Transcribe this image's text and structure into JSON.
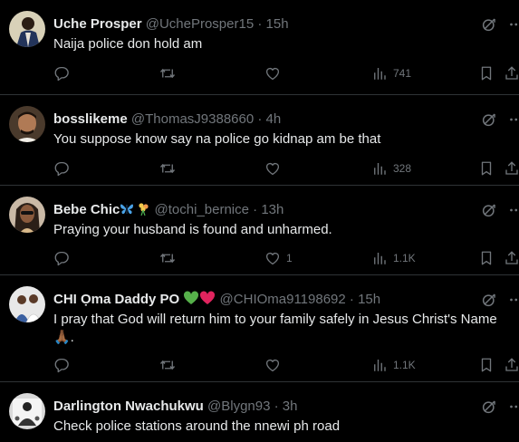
{
  "colors": {
    "background": "#000000",
    "text": "#e7e9ea",
    "muted": "#71767b",
    "divider": "#2f3336"
  },
  "icons": {
    "grok": "grok-icon",
    "more": "more-icon",
    "reply": "reply-icon",
    "retweet": "retweet-icon",
    "like": "heart-icon",
    "views": "views-chart-icon",
    "bookmark": "bookmark-icon",
    "share": "share-icon"
  },
  "tweets": [
    {
      "name": "Uche Prosper",
      "handle": "@UcheProsper15",
      "dot": "·",
      "time": "15h",
      "text": "Naija police don hold am",
      "likes": "",
      "views": "741"
    },
    {
      "name": "bosslikeme",
      "handle": "@ThomasJ9388660",
      "dot": "·",
      "time": "4h",
      "text": "You suppose know say na police go kidnap am be that",
      "likes": "",
      "views": "328"
    },
    {
      "name": "Bebe Chic",
      "handle": "@tochi_bernice",
      "dot": "·",
      "time": "13h",
      "text": "Praying your husband is found and unharmed.",
      "likes": "1",
      "views": "1.1K"
    },
    {
      "name": "CHI Ọma Daddy PO",
      "handle": "@CHIOma91198692",
      "dot": "·",
      "time": "15h",
      "text": "I pray that God will return him to your family safely in Jesus Christ's Name 🙏🏾.",
      "likes": "",
      "views": "1.1K"
    },
    {
      "name": "Darlington Nwachukwu",
      "handle": "@Blygn93",
      "dot": "·",
      "time": "3h",
      "text": "Check police stations around the nnewi ph road",
      "likes": "",
      "views": ""
    }
  ]
}
